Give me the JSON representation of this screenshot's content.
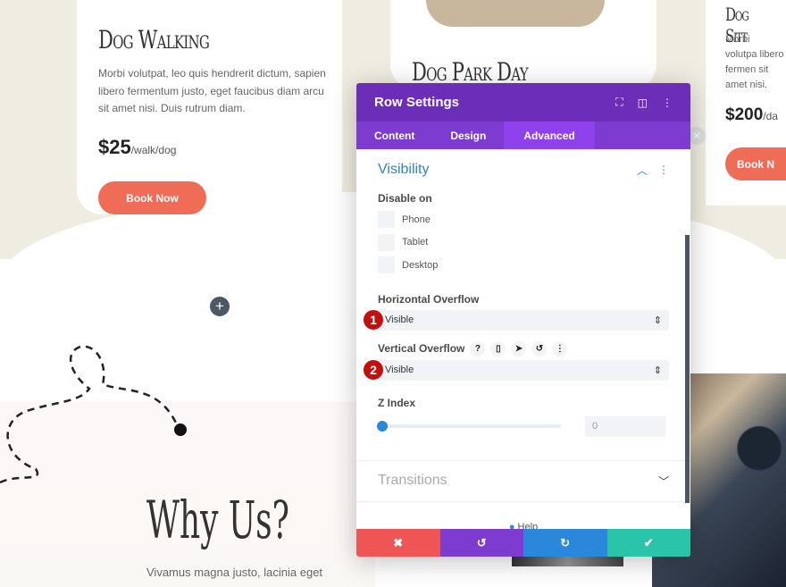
{
  "cards": [
    {
      "title": "Dog Walking",
      "text": "Morbi volutpat, leo quis hendrerit dictum, sapien libero fermentum justo, eget faucibus diam arcu sit amet nisi. Duis rutrum diam.",
      "price": "$25",
      "unit": "/walk/dog",
      "button": "Book Now"
    },
    {
      "title": "Dog Park Day"
    },
    {
      "title": "Dog Sitt",
      "text": "Morbi volutpa libero fermen sit amet nisi.",
      "price": "$200",
      "unit": "/da",
      "button": "Book N"
    }
  ],
  "why": {
    "title": "Why Us?",
    "text": "Vivamus magna justo, lacinia eget"
  },
  "modal": {
    "title": "Row Settings",
    "tabs": [
      "Content",
      "Design",
      "Advanced"
    ],
    "active_tab": "Advanced",
    "visibility": {
      "title": "Visibility",
      "disable_label": "Disable on",
      "options": [
        "Phone",
        "Tablet",
        "Desktop"
      ]
    },
    "h_overflow": {
      "label": "Horizontal Overflow",
      "value": "Visible",
      "badge": "1"
    },
    "v_overflow": {
      "label": "Vertical Overflow",
      "value": "Visible",
      "badge": "2"
    },
    "z_index": {
      "label": "Z Index",
      "value": "0",
      "slider": 0
    },
    "transitions": "Transitions",
    "help": "Help"
  },
  "colors": {
    "header": "#6c2eb9",
    "cancel": "#ef5555",
    "undo": "#7e3bd0",
    "redo": "#2b87da",
    "save": "#29c4a9"
  }
}
